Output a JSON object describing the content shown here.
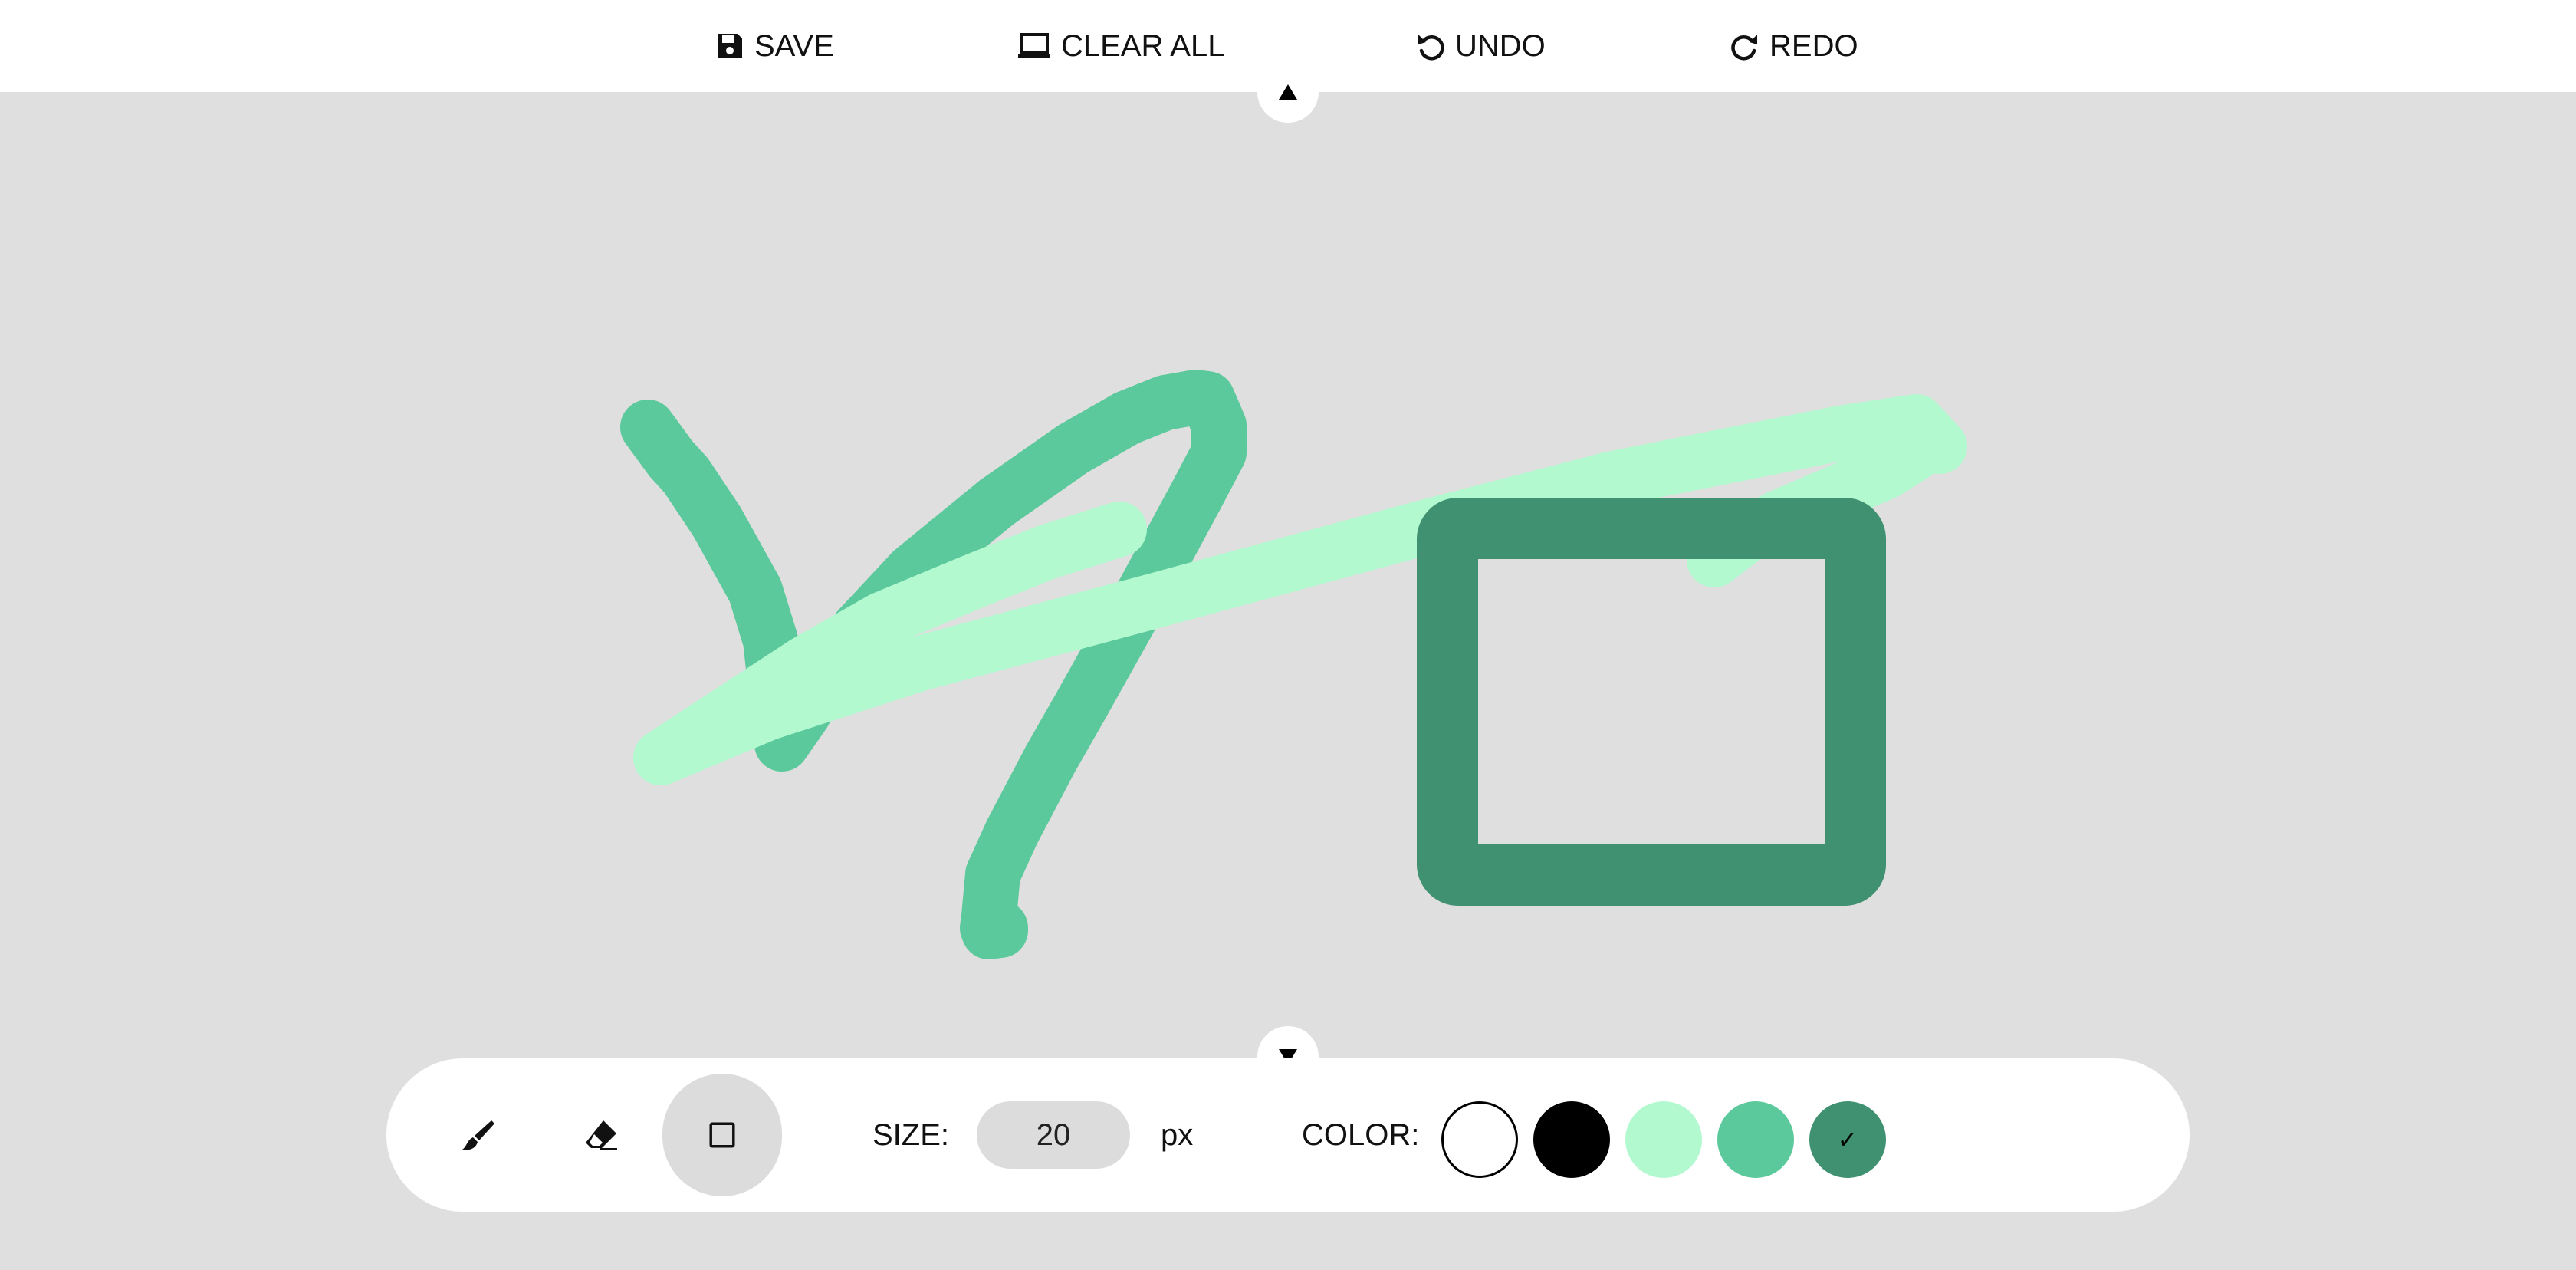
{
  "header": {
    "save_label": "SAVE",
    "clear_label": "CLEAR ALL",
    "undo_label": "UNDO",
    "redo_label": "REDO",
    "icons": [
      "floppy-icon",
      "monitor-icon",
      "undo-icon",
      "redo-icon"
    ]
  },
  "handles": {
    "top_icon": "caret-up-icon",
    "bottom_icon": "caret-down-icon"
  },
  "canvas": {
    "background": "#dfdfdf",
    "strokes": [
      {
        "tool": "brush",
        "color": "#5cc99c"
      },
      {
        "tool": "brush",
        "color": "#b3f9d0"
      },
      {
        "tool": "brush",
        "color": "#b3f9d0"
      },
      {
        "tool": "brush",
        "color": "#b3f9d0"
      },
      {
        "tool": "rectangle",
        "color": "#409171"
      }
    ]
  },
  "toolbar": {
    "tools": [
      {
        "id": "brush",
        "icon": "paintbrush-icon",
        "active": false
      },
      {
        "id": "eraser",
        "icon": "eraser-icon",
        "active": false
      },
      {
        "id": "rectangle",
        "icon": "square-icon",
        "active": true
      }
    ],
    "size_label": "SIZE:",
    "size_value": "20",
    "size_unit": "px",
    "color_label": "COLOR:",
    "colors": [
      {
        "hex": "#ffffff",
        "selected": false
      },
      {
        "hex": "#000000",
        "selected": false
      },
      {
        "hex": "#b3f9d0",
        "selected": false
      },
      {
        "hex": "#5cc99c",
        "selected": false
      },
      {
        "hex": "#409171",
        "selected": true
      }
    ],
    "selected_mark": "✓"
  }
}
